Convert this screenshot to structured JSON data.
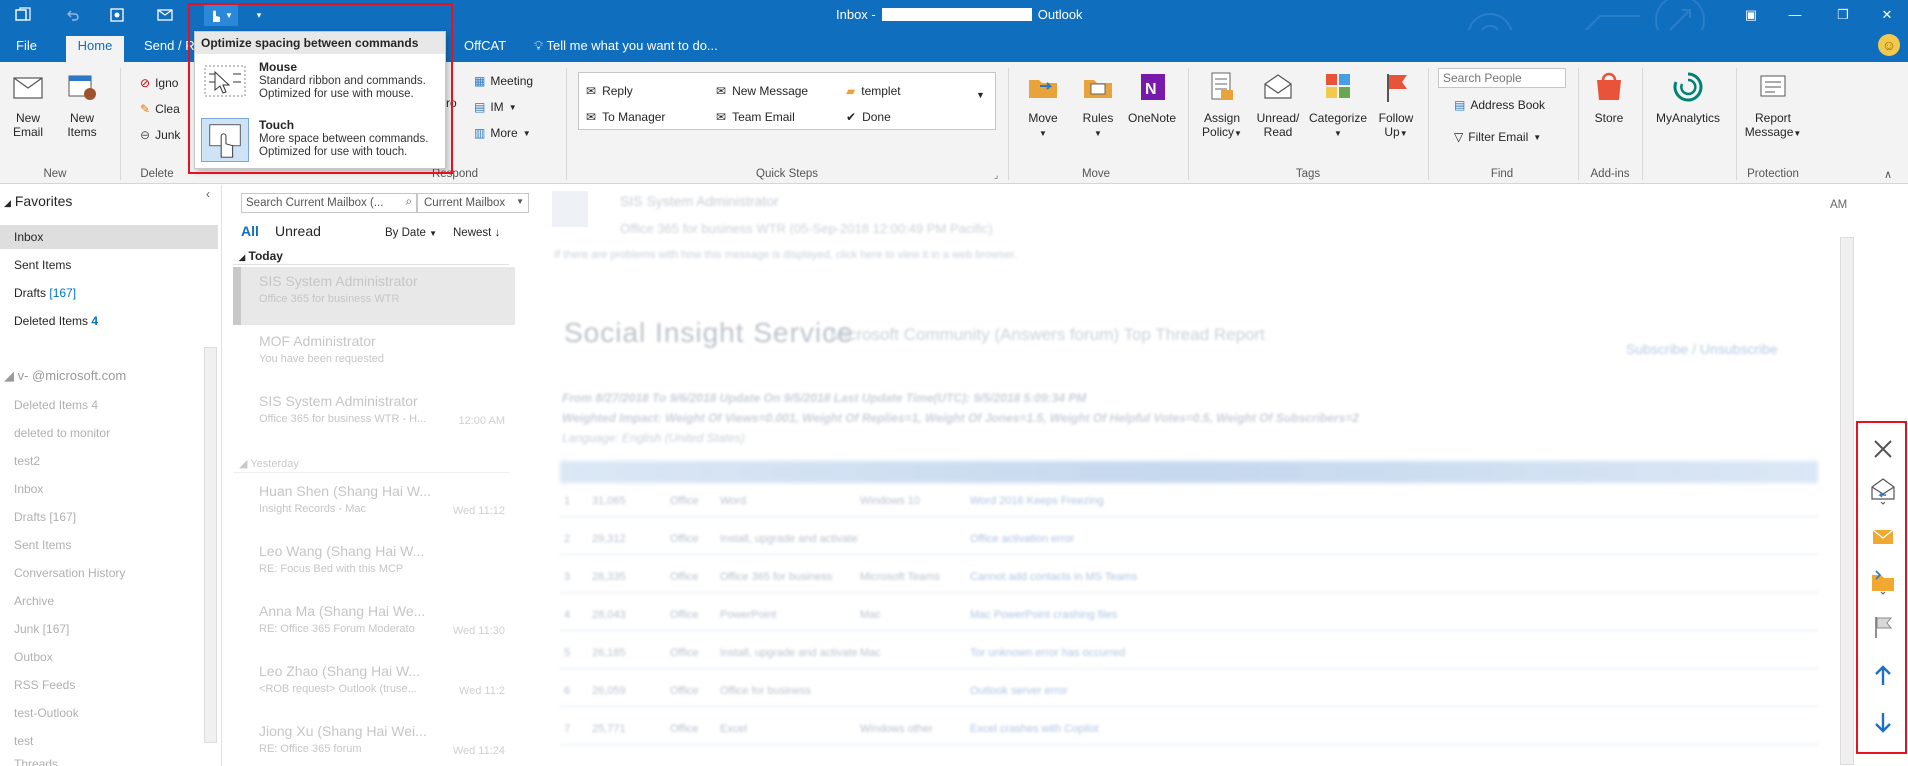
{
  "window": {
    "title_prefix": "Inbox -",
    "title_suffix": "Outlook"
  },
  "tabs": [
    {
      "label": "File"
    },
    {
      "label": "Home"
    },
    {
      "label": "Send / R"
    },
    {
      "label": "OffCAT"
    }
  ],
  "tell_me": "Tell me what you want to do...",
  "popup": {
    "header": "Optimize spacing between commands",
    "mouse_title": "Mouse",
    "mouse_desc": "Standard ribbon and commands. Optimized for use with mouse.",
    "touch_title": "Touch",
    "touch_desc": "More space between commands. Optimized for use with touch."
  },
  "ribbon": {
    "new": {
      "new_email": "New Email",
      "new_items": "New Items",
      "label": "New"
    },
    "delete": {
      "ignore": "Igno",
      "clean": "Clea",
      "junk": "Junk",
      "label": "Delete"
    },
    "respond": {
      "label": "Respond",
      "meeting": "Meeting",
      "im": "IM",
      "more": "More",
      "partial": "ro"
    },
    "quick_steps": {
      "label": "Quick Steps",
      "reply": "Reply",
      "new_message": "New Message",
      "templet": "templet",
      "to_manager": "To Manager",
      "team_email": "Team Email",
      "done": "Done"
    },
    "move": {
      "move": "Move",
      "rules": "Rules",
      "onenote": "OneNote",
      "label": "Move"
    },
    "tags": {
      "assign_policy": "Assign Policy",
      "unread_read": "Unread/ Read",
      "categorize": "Categorize",
      "follow_up": "Follow Up",
      "label": "Tags"
    },
    "find": {
      "search_people_placeholder": "Search People",
      "address_book": "Address Book",
      "filter_email": "Filter Email",
      "label": "Find"
    },
    "addins": {
      "store": "Store",
      "label": "Add-ins"
    },
    "myanalytics": {
      "label": "MyAnalytics"
    },
    "protection": {
      "report_message": "Report Message",
      "label": "Protection"
    }
  },
  "folders": {
    "favorites_header": "Favorites",
    "favorites": [
      {
        "name": "Inbox",
        "count": ""
      },
      {
        "name": "Sent Items",
        "count": ""
      },
      {
        "name": "Drafts",
        "count": "[167]"
      },
      {
        "name": "Deleted Items",
        "count": "4"
      }
    ],
    "account": "v-        @microsoft.com",
    "account_folders": [
      "Deleted Items 4",
      "deleted to monitor",
      "test2",
      "Inbox",
      "Drafts [167]",
      "Sent Items",
      "Conversation History",
      "Archive",
      "Junk [167]",
      "Outbox",
      "RSS Feeds",
      "test-Outlook",
      "test",
      "Threads"
    ]
  },
  "message_list": {
    "search_placeholder": "Search Current Mailbox (...",
    "scope": "Current Mailbox",
    "filter_all": "All",
    "filter_unread": "Unread",
    "sort_by": "By Date",
    "order": "Newest",
    "group_today": "Today",
    "group_yesterday": "Yesterday",
    "messages": [
      {
        "from": "SIS System Administrator",
        "subject": "Office 365 for business WTR",
        "date": ""
      },
      {
        "from": "MOF Administrator",
        "subject": "You have been requested",
        "date": ""
      },
      {
        "from": "SIS System Administrator",
        "subject": "Office 365 for business WTR - H...",
        "date": "12:00 AM"
      },
      {
        "from": "Huan Shen (Shang Hai W...",
        "subject": "Insight Records - Mac",
        "date": "Wed 11:12"
      },
      {
        "from": "Leo Wang (Shang Hai W...",
        "subject": "RE: Focus Bed with this MCP",
        "date": ""
      },
      {
        "from": "Anna Ma (Shang Hai We...",
        "subject": "RE: Office 365 Forum Moderato",
        "date": "Wed 11:30"
      },
      {
        "from": "Leo Zhao (Shang Hai W...",
        "subject": "<ROB request> Outlook (truse...",
        "date": "Wed 11:2"
      },
      {
        "from": "Jiong Xu (Shang Hai Wei...",
        "subject": "RE: Office 365 forum",
        "date": "Wed 11:24"
      }
    ]
  },
  "reading": {
    "sender": "SIS System Administrator",
    "subject": "Office 365 for business WTR (05-Sep-2018 12:00:49 PM Pacific)",
    "info": "If there are problems with how this message is displayed, click here to view it in a web browser.",
    "time": "AM",
    "brand": "Social Insight Service",
    "report_title": "Microsoft Community (Answers forum) Top Thread Report",
    "subscribe": "Subscribe / Unsubscribe",
    "range_line": "From 8/27/2018 To 9/6/2018 Update On 9/5/2018 Last Update Time(UTC): 9/5/2018 5:09:34 PM",
    "weights_line": "Weighted Impact: Weight Of Views=0.001, Weight Of Replies=1, Weight Of Jones=1.5, Weight Of Helpful Votes=0.5, Weight Of Subscribers=2",
    "lang_line": "Language: English (United States)",
    "rows": [
      {
        "rank": "1",
        "id": "31,065",
        "product": "Office",
        "topic": "Word",
        "platform": "Windows 10",
        "title": "Word 2016 Keeps Freezing"
      },
      {
        "rank": "2",
        "id": "29,312",
        "product": "Office",
        "topic": "Install, upgrade and activate",
        "platform": "",
        "title": "Office activation error"
      },
      {
        "rank": "3",
        "id": "28,335",
        "product": "Office",
        "topic": "Office 365 for business",
        "platform": "Microsoft Teams",
        "title": "Cannot add contacts in MS Teams"
      },
      {
        "rank": "4",
        "id": "28,043",
        "product": "Office",
        "topic": "PowerPoint",
        "platform": "Mac",
        "title": "Mac PowerPoint crashing files"
      },
      {
        "rank": "5",
        "id": "26,185",
        "product": "Office",
        "topic": "Install, upgrade and activate",
        "platform": "Mac",
        "title": "Tor unknown error has occurred"
      },
      {
        "rank": "6",
        "id": "26,059",
        "product": "Office",
        "topic": "Office for business",
        "platform": "",
        "title": "Outlook server error"
      },
      {
        "rank": "7",
        "id": "25,771",
        "product": "Office",
        "topic": "Excel",
        "platform": "Windows other",
        "title": "Excel crashes with Copilot"
      }
    ]
  },
  "colors": {
    "accent": "#106ebe",
    "highlight_box": "#e81123"
  }
}
